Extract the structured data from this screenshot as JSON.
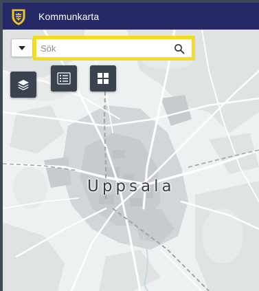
{
  "app": {
    "title": "Kommunkarta",
    "logo_icon": "municipal-crest-icon",
    "header_color": "#252a67"
  },
  "search": {
    "value": "",
    "placeholder": "Sök",
    "highlight_color": "#f3dd24",
    "icon": "magnifier-icon",
    "dropdown_icon": "caret-down-icon"
  },
  "tools": [
    {
      "name": "layers",
      "icon": "layers-icon"
    },
    {
      "name": "legend",
      "icon": "list-icon"
    },
    {
      "name": "themes",
      "icon": "grid-icon"
    }
  ],
  "map": {
    "place_label": "Uppsala"
  }
}
